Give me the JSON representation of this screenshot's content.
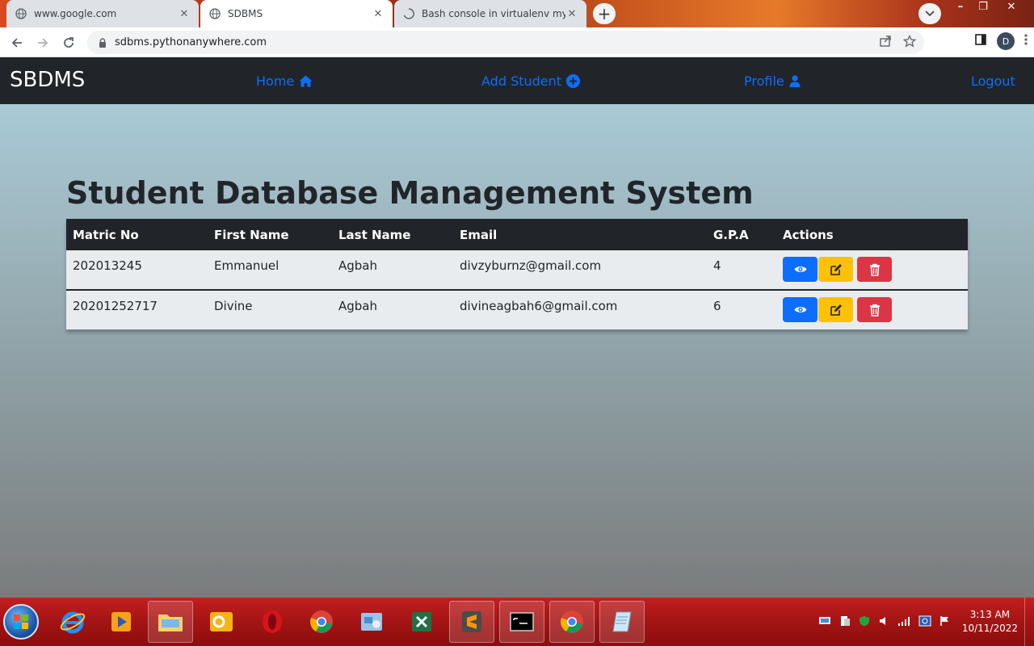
{
  "browser": {
    "tabs": [
      {
        "title": "www.google.com",
        "active": false
      },
      {
        "title": "SDBMS",
        "active": true
      },
      {
        "title": "Bash console in virtualenv myvirt",
        "active": false
      }
    ],
    "url": "sdbms.pythonanywhere.com",
    "profile_initial": "D"
  },
  "app": {
    "brand": "SBDMS",
    "nav": {
      "home": "Home",
      "add_student": "Add Student",
      "profile": "Profile",
      "logout": "Logout"
    },
    "heading": "Student Database Management System",
    "table": {
      "columns": [
        "Matric No",
        "First Name",
        "Last Name",
        "Email",
        "G.P.A",
        "Actions"
      ],
      "rows": [
        {
          "matric_no": "202013245",
          "first_name": "Emmanuel",
          "last_name": "Agbah",
          "email": "divzyburnz@gmail.com",
          "gpa": "4"
        },
        {
          "matric_no": "20201252717",
          "first_name": "Divine",
          "last_name": "Agbah",
          "email": "divineagbah6@gmail.com",
          "gpa": "6"
        }
      ]
    },
    "colors": {
      "primary": "#0d6efd",
      "warning": "#ffc107",
      "danger": "#dc3545",
      "dark": "#212529"
    }
  },
  "taskbar": {
    "time": "3:13 AM",
    "date": "10/11/2022"
  }
}
